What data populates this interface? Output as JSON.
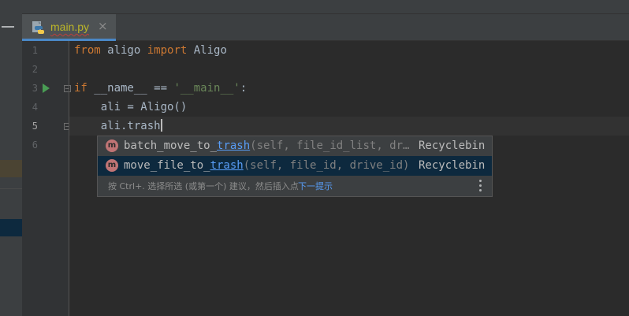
{
  "tab": {
    "file_name": "main.py",
    "close_glyph": "×",
    "icon": "python-file-icon"
  },
  "gutter": {
    "line_numbers": [
      "1",
      "2",
      "3",
      "4",
      "5",
      "6"
    ],
    "active_line": "5"
  },
  "code": {
    "line1": {
      "kw1": "from",
      "mid": " aligo ",
      "kw2": "import",
      "end": " Aligo"
    },
    "line3": {
      "kw": "if",
      "mid": " __name__ == ",
      "str": "'__main__'",
      "end": ":"
    },
    "line4": "    ali = Aligo()",
    "line5": "    ali.trash"
  },
  "completion": {
    "items": [
      {
        "icon": "m",
        "prefix": "batch_move_to_",
        "match": "trash",
        "params": "(self, file_id_list, dr…",
        "type": "Recyclebin",
        "selected": false
      },
      {
        "icon": "m",
        "prefix": "move_file_to_",
        "match": "trash",
        "params": "(self, file_id, drive_id)",
        "type": "Recyclebin",
        "selected": true
      }
    ],
    "hint": "按 Ctrl+. 选择所选 (或第一个) 建议，然后插入点",
    "next_tip": "下一提示"
  },
  "colors": {
    "keyword": "#cc7832",
    "string": "#6a8759",
    "match": "#589df6",
    "selection": "#0d293e",
    "run": "#499c54"
  }
}
